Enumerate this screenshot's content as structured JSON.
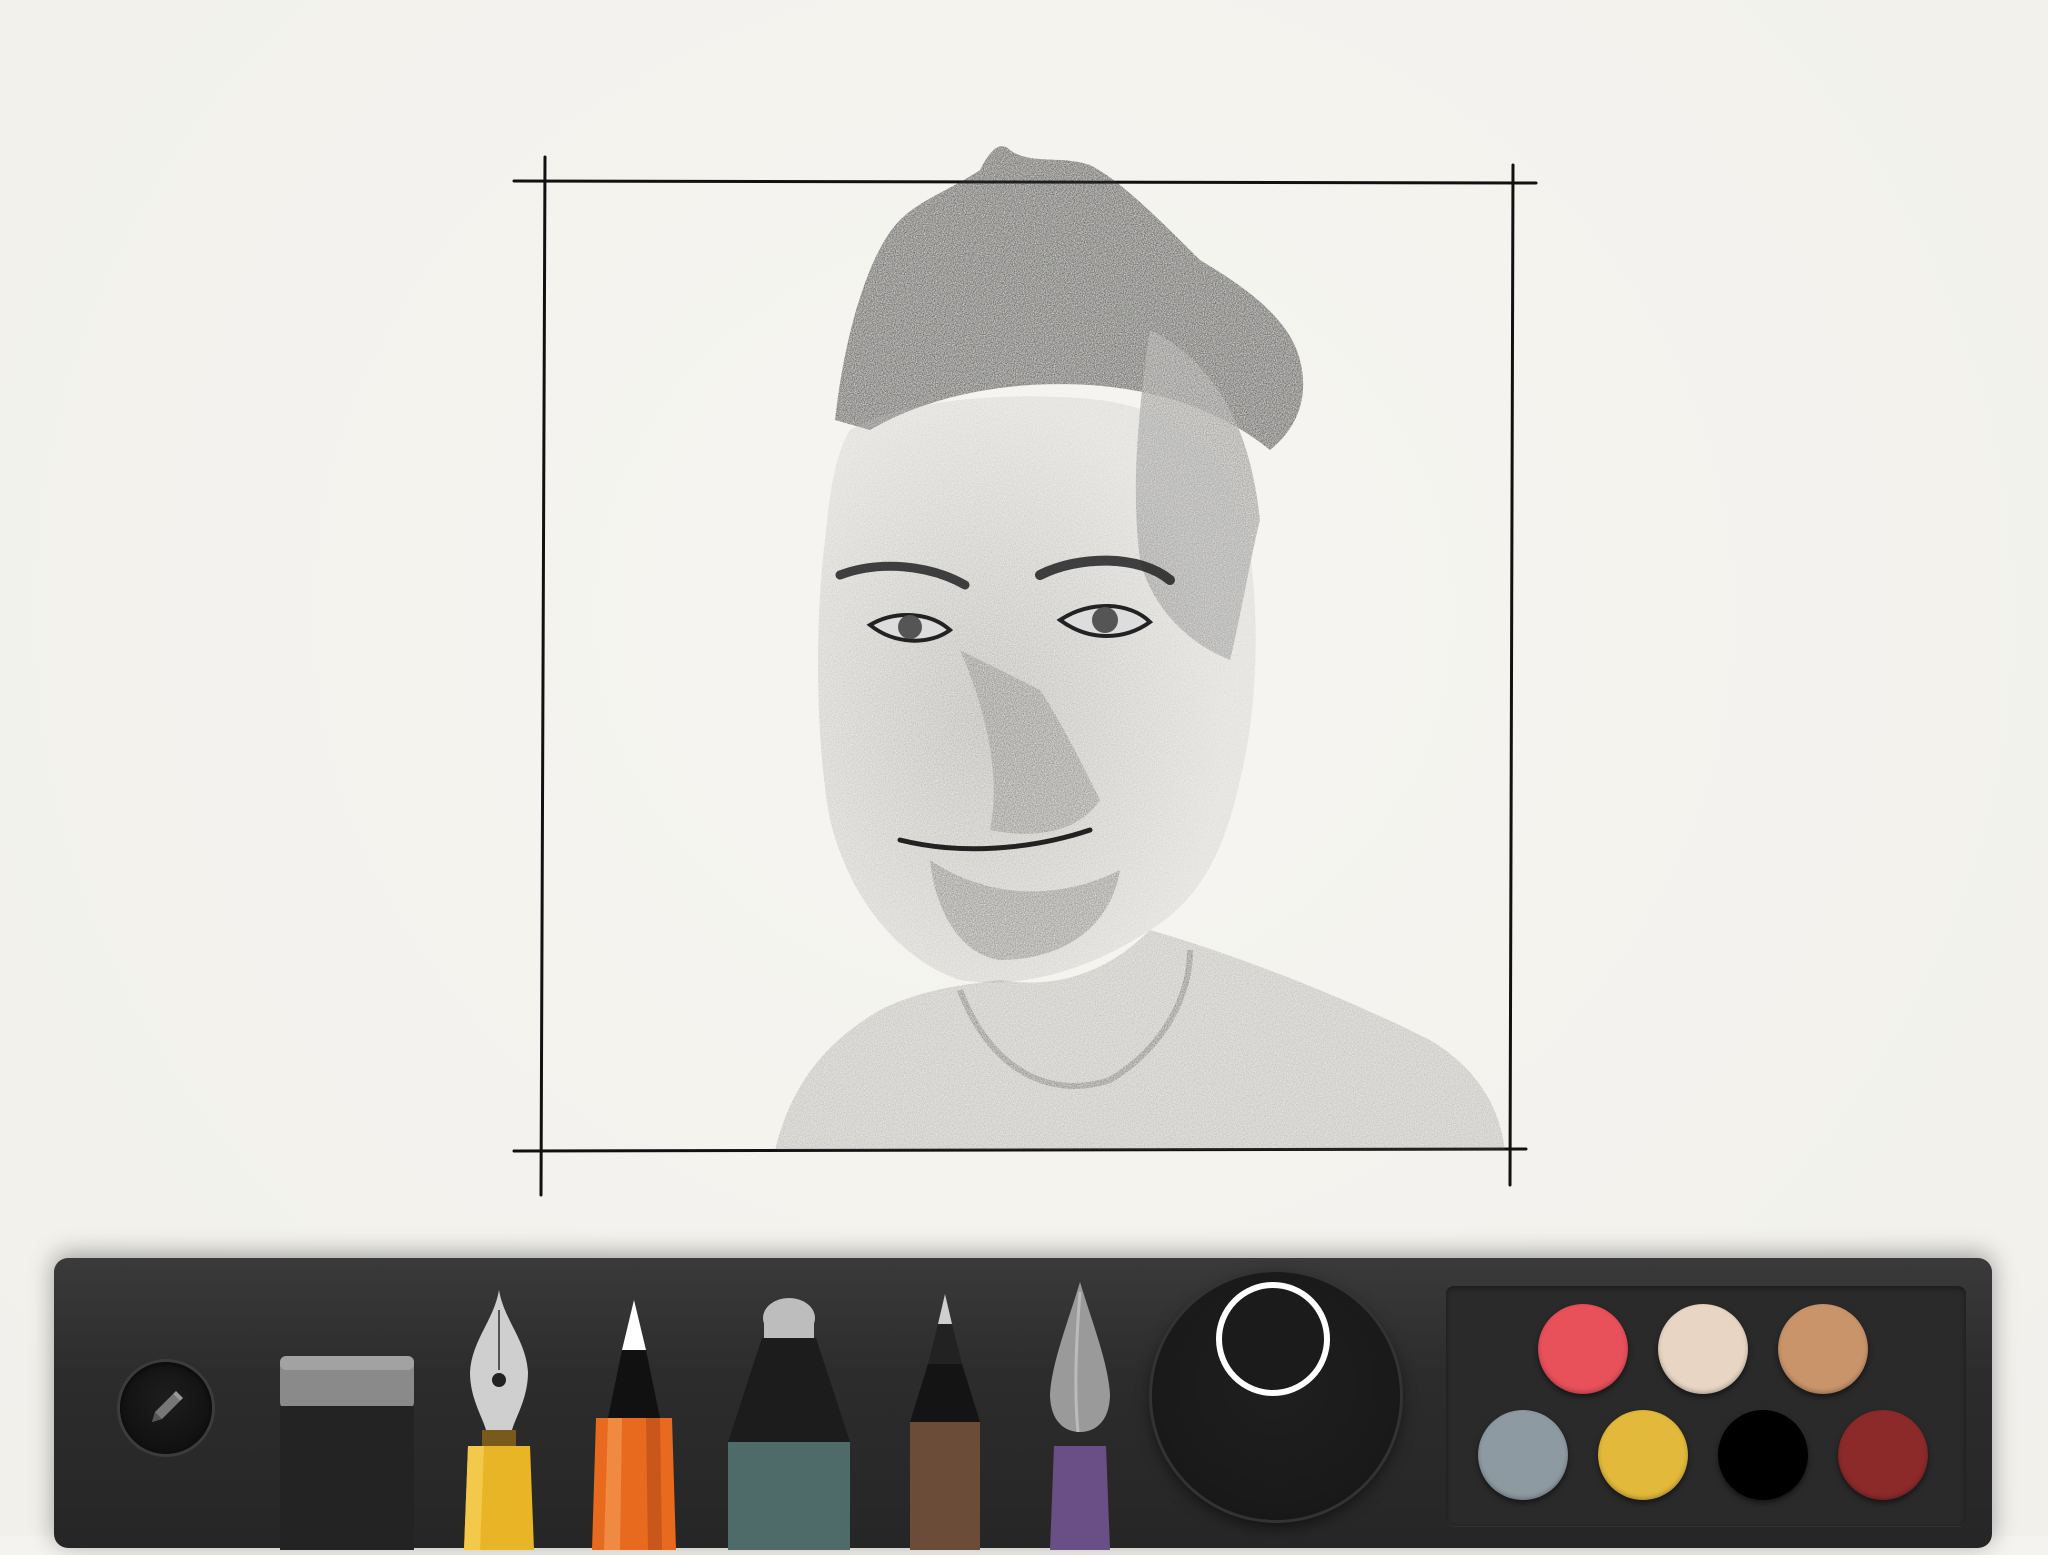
{
  "app": {
    "canvas_color": "#f4f3ef"
  },
  "toolbar": {
    "mode_button": {
      "icon": "pencil-icon"
    },
    "tools": [
      {
        "id": "eraser",
        "icon": "eraser-icon"
      },
      {
        "id": "fountain-pen",
        "icon": "fountain-pen-icon",
        "color": "#e8b526"
      },
      {
        "id": "pencil",
        "icon": "pencil-tool-icon",
        "color": "#e86a1e",
        "selected": true
      },
      {
        "id": "marker",
        "icon": "marker-icon",
        "color": "#4e6b69"
      },
      {
        "id": "fine-pen",
        "icon": "fine-pen-icon",
        "color": "#6b4c38"
      },
      {
        "id": "brush",
        "icon": "paintbrush-icon",
        "color": "#6a4f86"
      }
    ],
    "brush_size_color": "#1b1b1b"
  },
  "palette": {
    "swatches": [
      "#e8505a",
      "#e8d5c3",
      "#c9946a",
      "#8e9aa2",
      "#e2b93a",
      "#000000",
      "#8c2a2a"
    ]
  }
}
